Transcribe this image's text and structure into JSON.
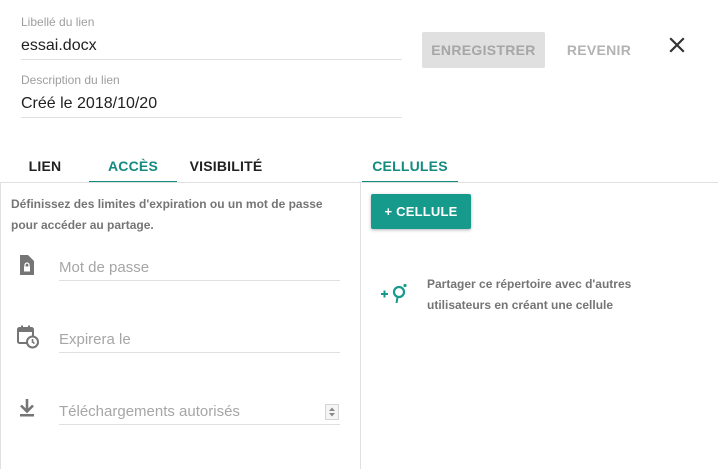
{
  "header": {
    "link_label": {
      "label": "Libellé du lien",
      "value": "essai.docx"
    },
    "link_description": {
      "label": "Description du lien",
      "value": "Créé le 2018/10/20"
    },
    "save_label": "ENREGISTRER",
    "back_label": "REVENIR",
    "close_icon": "close-icon"
  },
  "tabs": [
    {
      "label": "LIEN",
      "active": false
    },
    {
      "label": "ACCÈS",
      "active": true
    },
    {
      "label": "VISIBILITÉ",
      "active": false
    }
  ],
  "right_tab": {
    "label": "CELLULES",
    "active": true
  },
  "access": {
    "description": "Définissez des limites d'expiration ou un mot de passe pour accéder au partage.",
    "password": {
      "icon": "lock-file-icon",
      "placeholder": "Mot de passe"
    },
    "expire": {
      "icon": "calendar-clock-icon",
      "placeholder": "Expirera le"
    },
    "downloads": {
      "icon": "download-icon",
      "placeholder": "Téléchargements autorisés"
    }
  },
  "cells": {
    "add_button_label": "+ CELLULE",
    "share_icon": "add-cell-icon",
    "share_text": "Partager ce répertoire avec d'autres utilisateurs en créant une cellule"
  },
  "colors": {
    "accent": "#138b7e",
    "accent_button": "#159a8c",
    "disabled_button": "#e0e0e0"
  }
}
